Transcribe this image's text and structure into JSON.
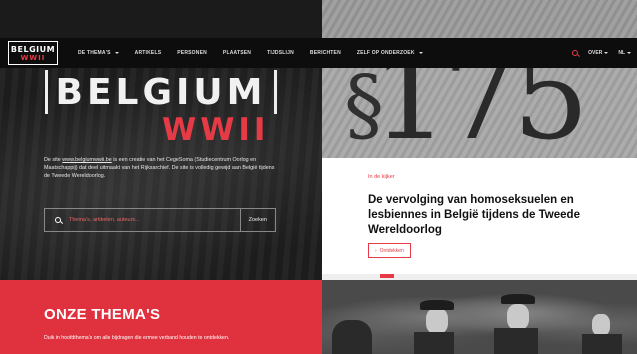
{
  "logo": {
    "line1": "BELGIUM",
    "line2": "WWII"
  },
  "nav": {
    "items": [
      {
        "label": "DE THEMA'S",
        "dropdown": true
      },
      {
        "label": "ARTIKELS",
        "dropdown": false
      },
      {
        "label": "PERSONEN",
        "dropdown": false
      },
      {
        "label": "PLAATSEN",
        "dropdown": false
      },
      {
        "label": "TIJDSLIJN",
        "dropdown": false
      },
      {
        "label": "BERICHTEN",
        "dropdown": false
      },
      {
        "label": "ZELF OP ONDERZOEK",
        "dropdown": true
      }
    ],
    "over_label": "OVER",
    "language_label": "NL"
  },
  "hero": {
    "title_line1": "BELGIUM",
    "title_line2": "WWII",
    "intro_prefix": "De site",
    "intro_link": "www.belgiumwwii.be",
    "intro_rest": "is een creatie van het CegeSoma (Studiecentrum Oorlog en Maatschappij) dat deel uitmaakt van het Rijksarchief. De site is volledig gewijd aan België tijdens de Tweede Wereldoorlog.",
    "search_placeholder": "Thema's, artikelen, auteurs...",
    "search_button": "Zoeken"
  },
  "feature": {
    "kicker": "In de kijker",
    "title": "De vervolging van homoseksuelen en lesbiennes in België tijdens de Tweede Wereldoorlog",
    "button": "Ontdekken"
  },
  "themes": {
    "title": "ONZE THEMA'S",
    "text": "Duik in hoofdthema's om alle bijdragen die ermee verband houden te ontdekken."
  },
  "colors": {
    "accent": "#e63b46",
    "header_bg": "#0d0d0d",
    "themes_bg": "#e0313f"
  },
  "icons": {
    "search": "search-icon",
    "dropdown": "chevron-down-icon",
    "arrow": "arrow-right-icon"
  }
}
